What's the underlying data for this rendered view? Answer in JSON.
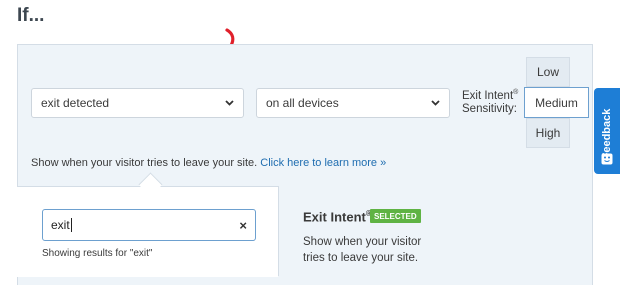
{
  "heading": "If...",
  "trigger_select": {
    "value": "exit detected"
  },
  "device_select": {
    "value": "on all devices"
  },
  "sensitivity": {
    "label": "Exit Intent",
    "label_mark": "®",
    "label_suffix": "Sensitivity:",
    "options": [
      "Low",
      "Medium",
      "High"
    ],
    "selected": "Medium"
  },
  "feedback_tab": {
    "label": "Feedback"
  },
  "hint": {
    "text": "Show when your visitor tries to leave your site.",
    "link": "Click here to learn more »"
  },
  "search": {
    "value": "exit",
    "clear_icon": "×",
    "results_text": "Showing results for \"exit\""
  },
  "option": {
    "title": "Exit Intent",
    "title_mark": "®",
    "badge": "SELECTED",
    "description": "Show when your visitor tries to leave your site."
  },
  "colors": {
    "accent": "#1e7ed6",
    "badge": "#5fb344",
    "arrow": "#e0202b",
    "panel": "#eef4f9"
  }
}
